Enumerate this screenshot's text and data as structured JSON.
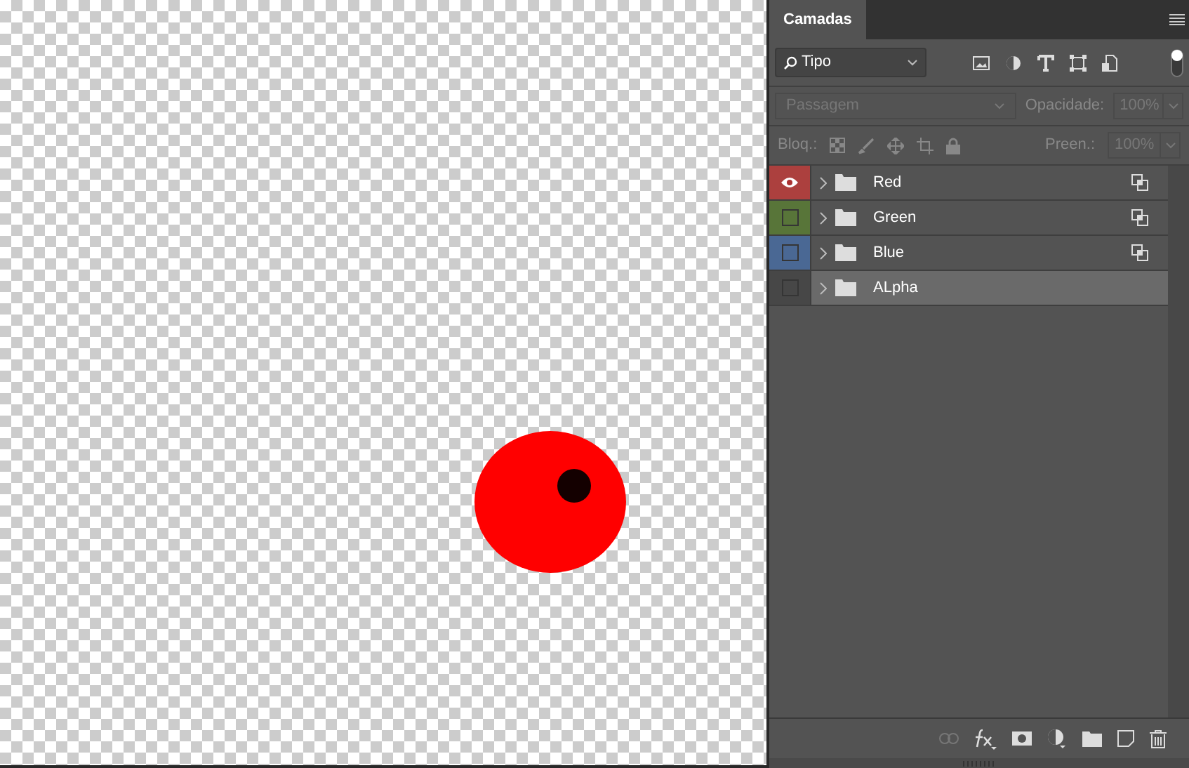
{
  "panel": {
    "tab": "Camadas",
    "filter": "Tipo",
    "blend_mode": "Passagem",
    "opacity_label": "Opacidade:",
    "opacity": "100%",
    "lock_label": "Bloq.:",
    "fill_label": "Preen.:",
    "fill": "100%",
    "filter_on": true
  },
  "layers": [
    {
      "name": "Red",
      "color": "#ac403e",
      "visible": true,
      "selected": false,
      "linked": true
    },
    {
      "name": "Green",
      "color": "#587539",
      "visible": false,
      "selected": false,
      "linked": true
    },
    {
      "name": "Blue",
      "color": "#4a6894",
      "visible": false,
      "selected": false,
      "linked": true
    },
    {
      "name": "ALpha",
      "visible": false,
      "selected": true,
      "linked": false
    }
  ]
}
